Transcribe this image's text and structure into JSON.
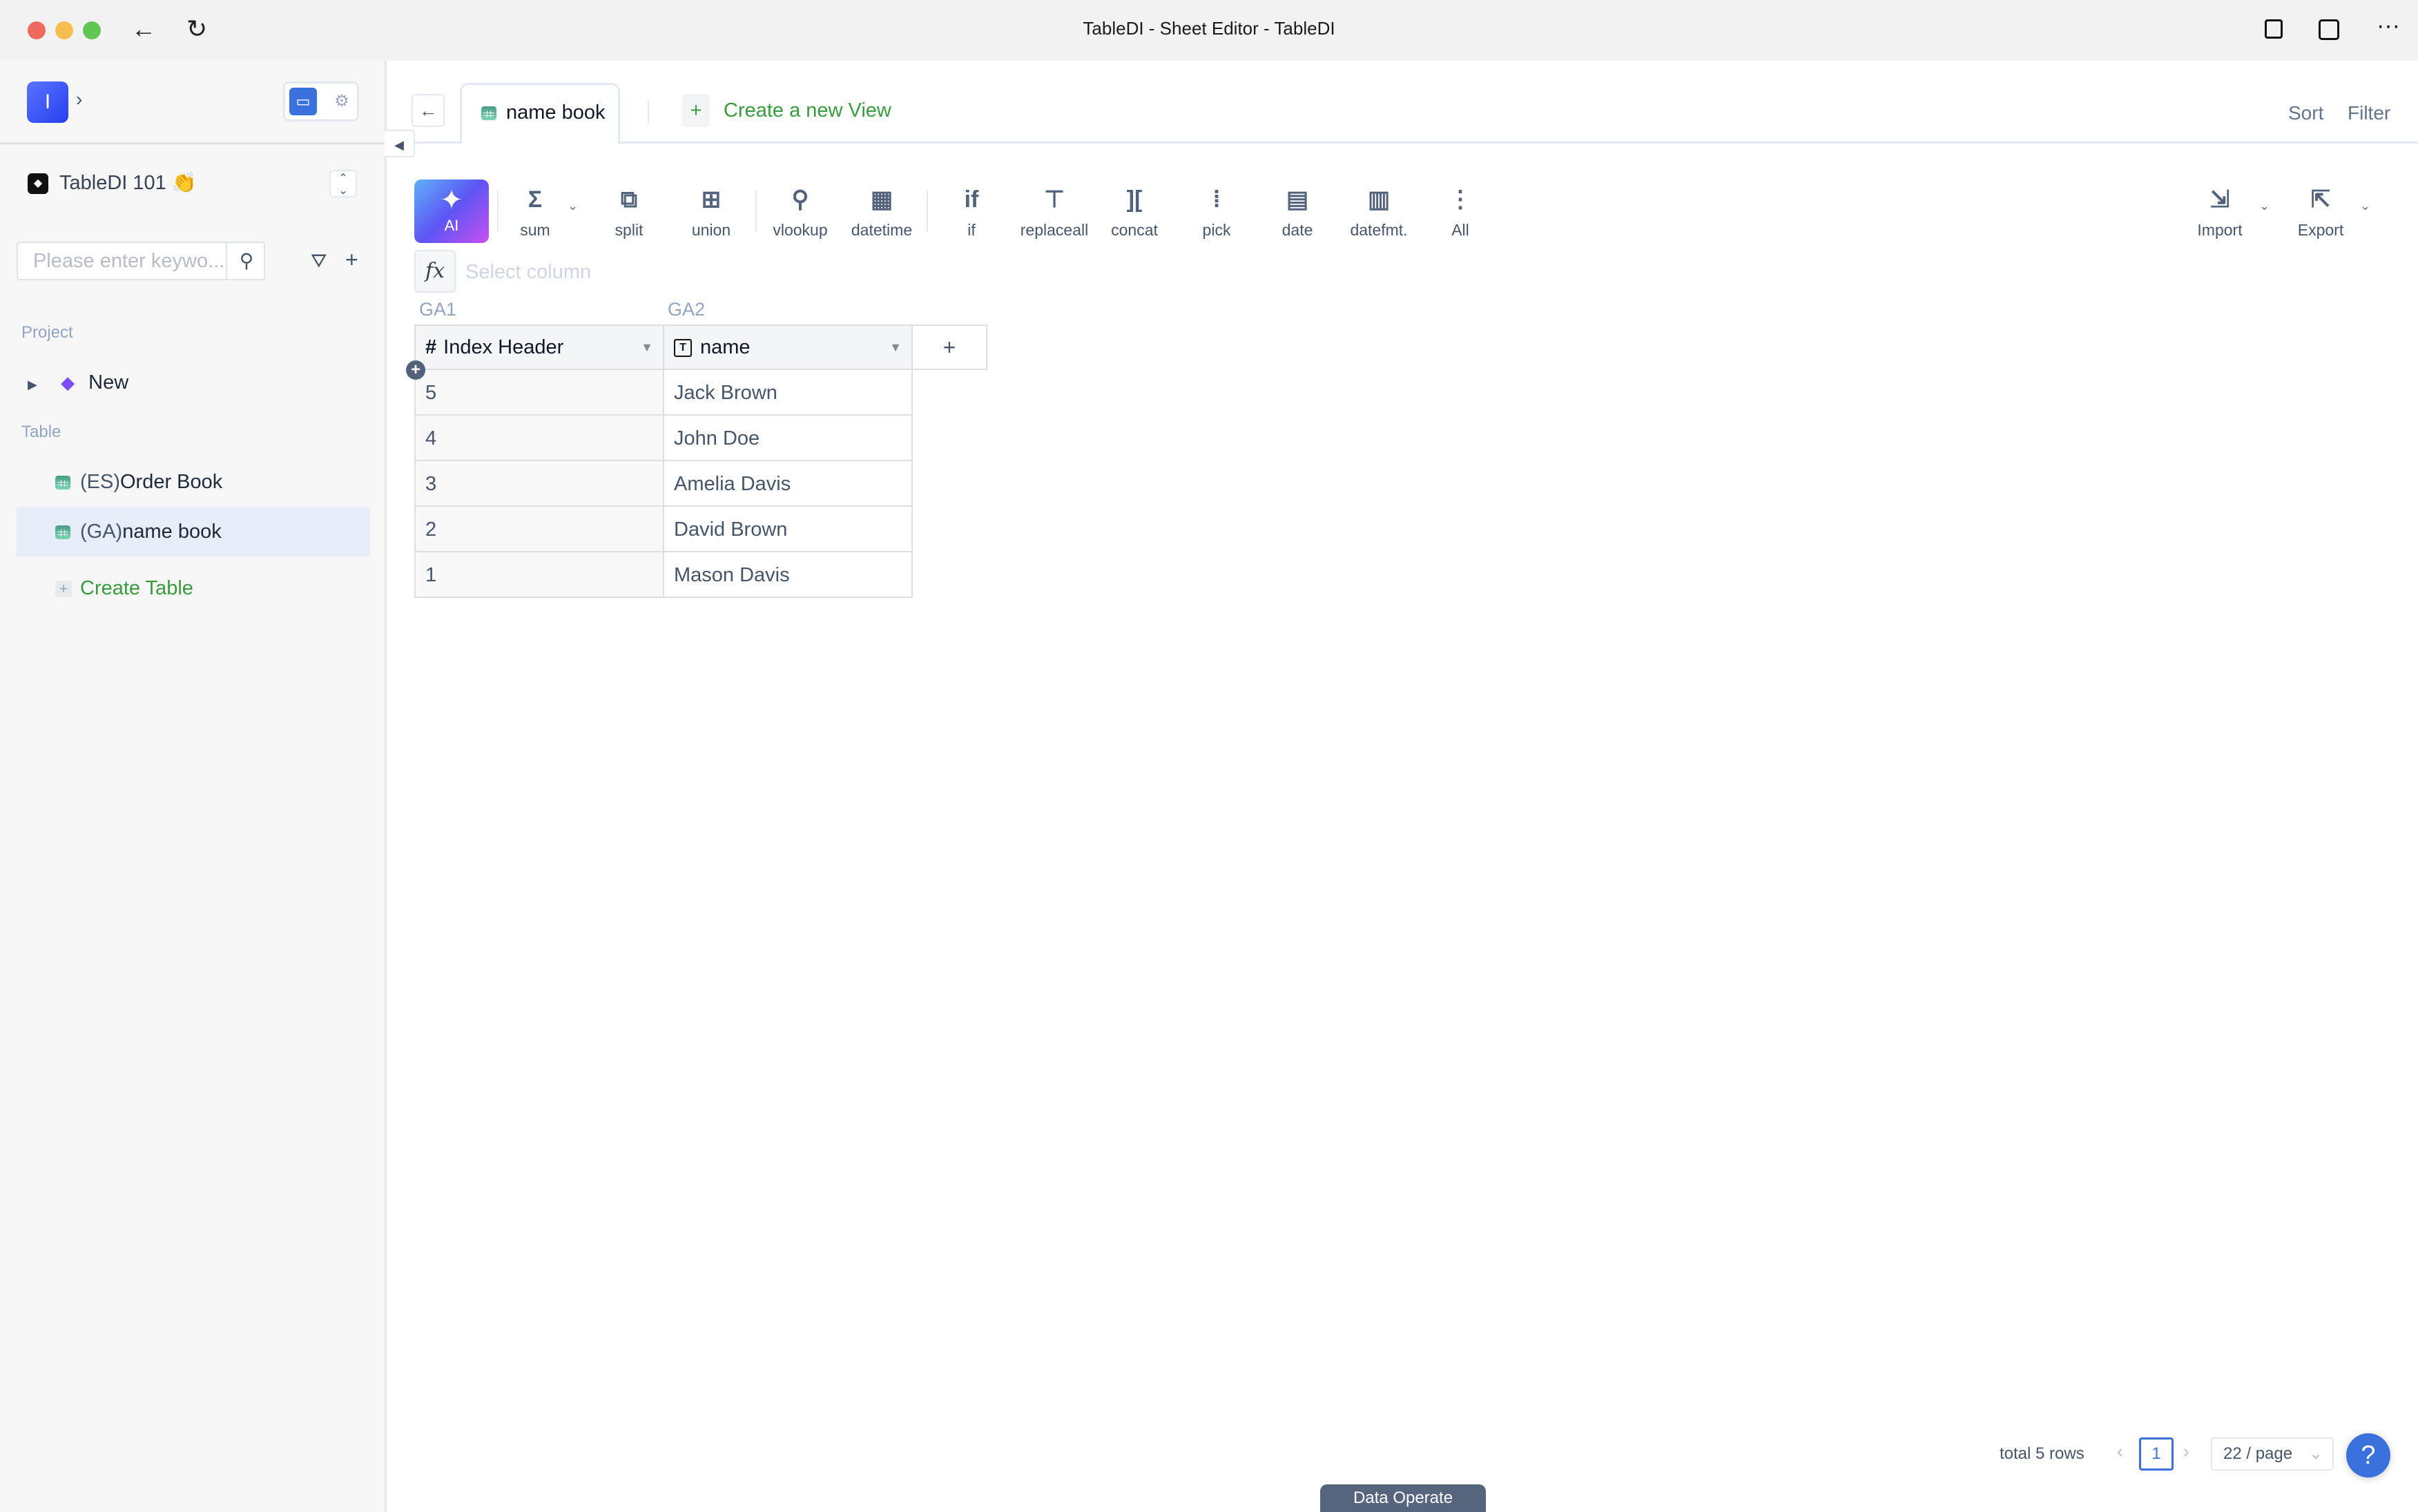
{
  "window": {
    "title": "TableDI - Sheet Editor - TableDI",
    "traffic_lights": {
      "close": "#ee6a5f",
      "minimize": "#f5be4f",
      "zoom": "#62c554"
    },
    "nav_icons": [
      "back-arrow-icon",
      "reload-icon"
    ],
    "right_icons": [
      "clipboard-icon",
      "screen-search-icon",
      "more-icon"
    ]
  },
  "sidebar": {
    "avatar_letter": "I",
    "workspace": {
      "name": "TableDI 101 👏"
    },
    "search": {
      "placeholder": "Please enter keywo...",
      "value": ""
    },
    "sections": {
      "project_label": "Project",
      "table_label": "Table"
    },
    "projects": [
      {
        "label": "New",
        "icon": "layers-icon"
      }
    ],
    "tables": [
      {
        "prefix": "(ES)",
        "name": "Order Book",
        "selected": false
      },
      {
        "prefix": "(GA)",
        "name": "name book",
        "selected": true
      }
    ],
    "create_table_label": "Create Table"
  },
  "header": {
    "active_tab": "name book",
    "create_view_label": "Create a new View",
    "sort_label": "Sort",
    "filter_label": "Filter"
  },
  "toolbar": {
    "ai_label": "AI",
    "tools": [
      {
        "label": "sum",
        "icon": "sigma-icon",
        "glyph": "Σ"
      },
      {
        "label": "split",
        "icon": "split-icon",
        "glyph": "⧉"
      },
      {
        "label": "union",
        "icon": "union-icon",
        "glyph": "⊞"
      },
      {
        "label": "vlookup",
        "icon": "search-icon",
        "glyph": "⚲"
      },
      {
        "label": "datetime",
        "icon": "calendar-arrows-icon",
        "glyph": "▦"
      },
      {
        "label": "if",
        "icon": "if-icon",
        "glyph": "if"
      },
      {
        "label": "replaceall",
        "icon": "replace-icon",
        "glyph": "⊤"
      },
      {
        "label": "concat",
        "icon": "concat-icon",
        "glyph": "]["
      },
      {
        "label": "pick",
        "icon": "pick-icon",
        "glyph": "⁞"
      },
      {
        "label": "date",
        "icon": "calendar-icon",
        "glyph": "▤"
      },
      {
        "label": "datefmt.",
        "icon": "calendar-format-icon",
        "glyph": "▥"
      },
      {
        "label": "All",
        "icon": "more-vertical-icon",
        "glyph": "⋮"
      }
    ],
    "import_label": "Import",
    "export_label": "Export",
    "formula": {
      "placeholder": "Select column",
      "value": ""
    }
  },
  "grid": {
    "column_groups": [
      "GA1",
      "GA2"
    ],
    "columns": [
      {
        "type_icon": "#",
        "label": "Index Header"
      },
      {
        "type_icon": "T",
        "label": "name"
      }
    ],
    "rows": [
      [
        "5",
        "Jack Brown"
      ],
      [
        "4",
        "John Doe"
      ],
      [
        "3",
        "Amelia Davis"
      ],
      [
        "2",
        "David Brown"
      ],
      [
        "1",
        "Mason Davis"
      ]
    ]
  },
  "footer": {
    "total_label": "total 5 rows",
    "current_page": "1",
    "page_size": "22 / page",
    "help_label": "?",
    "data_operate_label": "Data Operate"
  }
}
